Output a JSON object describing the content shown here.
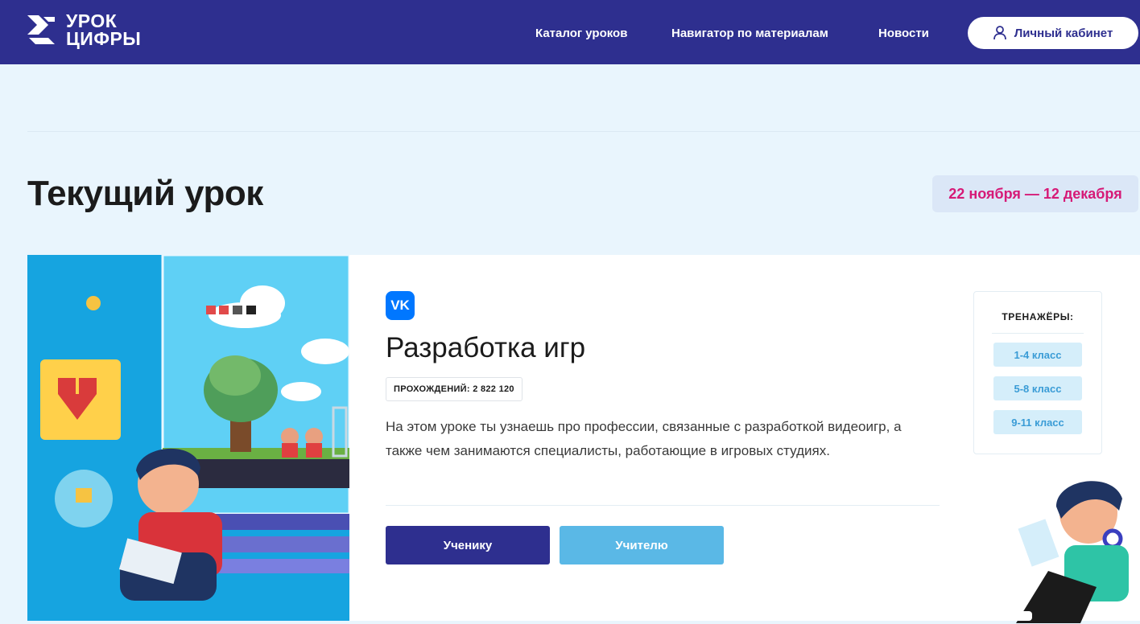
{
  "header": {
    "logo_line1": "УРОК",
    "logo_line2": "ЦИФРЫ",
    "nav": [
      "Каталог уроков",
      "Навигатор по материалам",
      "Новости"
    ],
    "cabinet_label": "Личный кабинет"
  },
  "main": {
    "title": "Текущий урок",
    "date_range": "22 ноября — 12 декабря"
  },
  "lesson": {
    "partner_logo": "VK",
    "title": "Разработка игр",
    "views": "ПРОХОЖДЕНИЙ: 2 822 120",
    "description": "На этом уроке ты узнаешь про профессии, связанные с разработкой видеоигр, а также чем занимаются специалисты, работающие в игровых студиях.",
    "student_button": "Ученику",
    "teacher_button": "Учителю"
  },
  "trainers": {
    "title": "ТРЕНАЖЁРЫ:",
    "grades": [
      "1-4 класс",
      "5-8 класс",
      "9-11 класс"
    ]
  },
  "colors": {
    "header_bg": "#2e2f8f",
    "accent_pink": "#d61a77",
    "student_btn": "#2e2f8f",
    "teacher_btn": "#5ab8e6",
    "page_bg": "#e9f5fd"
  }
}
